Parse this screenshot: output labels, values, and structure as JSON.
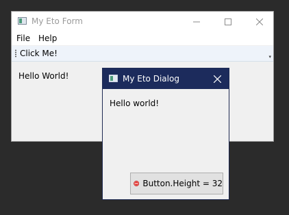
{
  "main_window": {
    "title": "My Eto Form",
    "menu": [
      "File",
      "Help"
    ],
    "toolbar_button": "Click Me!",
    "content_text": "Hello World!"
  },
  "dialog": {
    "title": "My Eto Dialog",
    "content_text": "Hello world!",
    "button_label": "Button.Height = 32"
  },
  "icons": {
    "app": "app-window-icon",
    "minimize": "minimize-icon",
    "maximize": "maximize-icon",
    "close": "close-icon",
    "overflow": "toolbar-overflow-icon",
    "button": "stop-icon"
  },
  "colors": {
    "desktop": "#2b2b2b",
    "dialog_titlebar": "#1c2b5c",
    "stop_icon": "#e0201c",
    "toolbar": "#eef3fa"
  }
}
